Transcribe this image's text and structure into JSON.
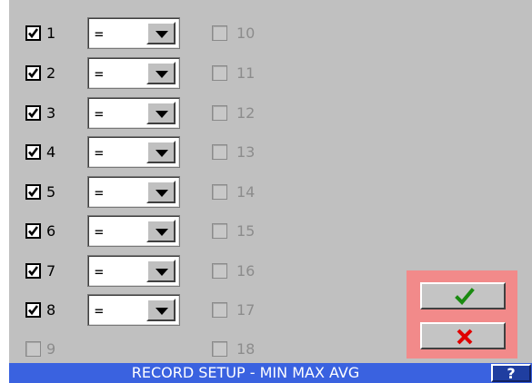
{
  "channels_left": [
    {
      "label": "1",
      "checked": true,
      "operator": "="
    },
    {
      "label": "2",
      "checked": true,
      "operator": "="
    },
    {
      "label": "3",
      "checked": true,
      "operator": "="
    },
    {
      "label": "4",
      "checked": true,
      "operator": "="
    },
    {
      "label": "5",
      "checked": true,
      "operator": "="
    },
    {
      "label": "6",
      "checked": true,
      "operator": "="
    },
    {
      "label": "7",
      "checked": true,
      "operator": "="
    },
    {
      "label": "8",
      "checked": true,
      "operator": "="
    },
    {
      "label": "9",
      "checked": false,
      "operator": null
    }
  ],
  "channels_right": [
    {
      "label": "10",
      "checked": false
    },
    {
      "label": "11",
      "checked": false
    },
    {
      "label": "12",
      "checked": false
    },
    {
      "label": "13",
      "checked": false
    },
    {
      "label": "14",
      "checked": false
    },
    {
      "label": "15",
      "checked": false
    },
    {
      "label": "16",
      "checked": false
    },
    {
      "label": "17",
      "checked": false
    },
    {
      "label": "18",
      "checked": false
    }
  ],
  "actions": {
    "ok_icon": "checkmark-icon",
    "cancel_icon": "close-icon",
    "ok_color": "#1a8a10",
    "cancel_color": "#e00000",
    "highlight_color": "#f28a8a"
  },
  "status_bar": {
    "title": "RECORD SETUP - MIN MAX AVG",
    "help_label": "?",
    "color": "#3a62e0"
  }
}
